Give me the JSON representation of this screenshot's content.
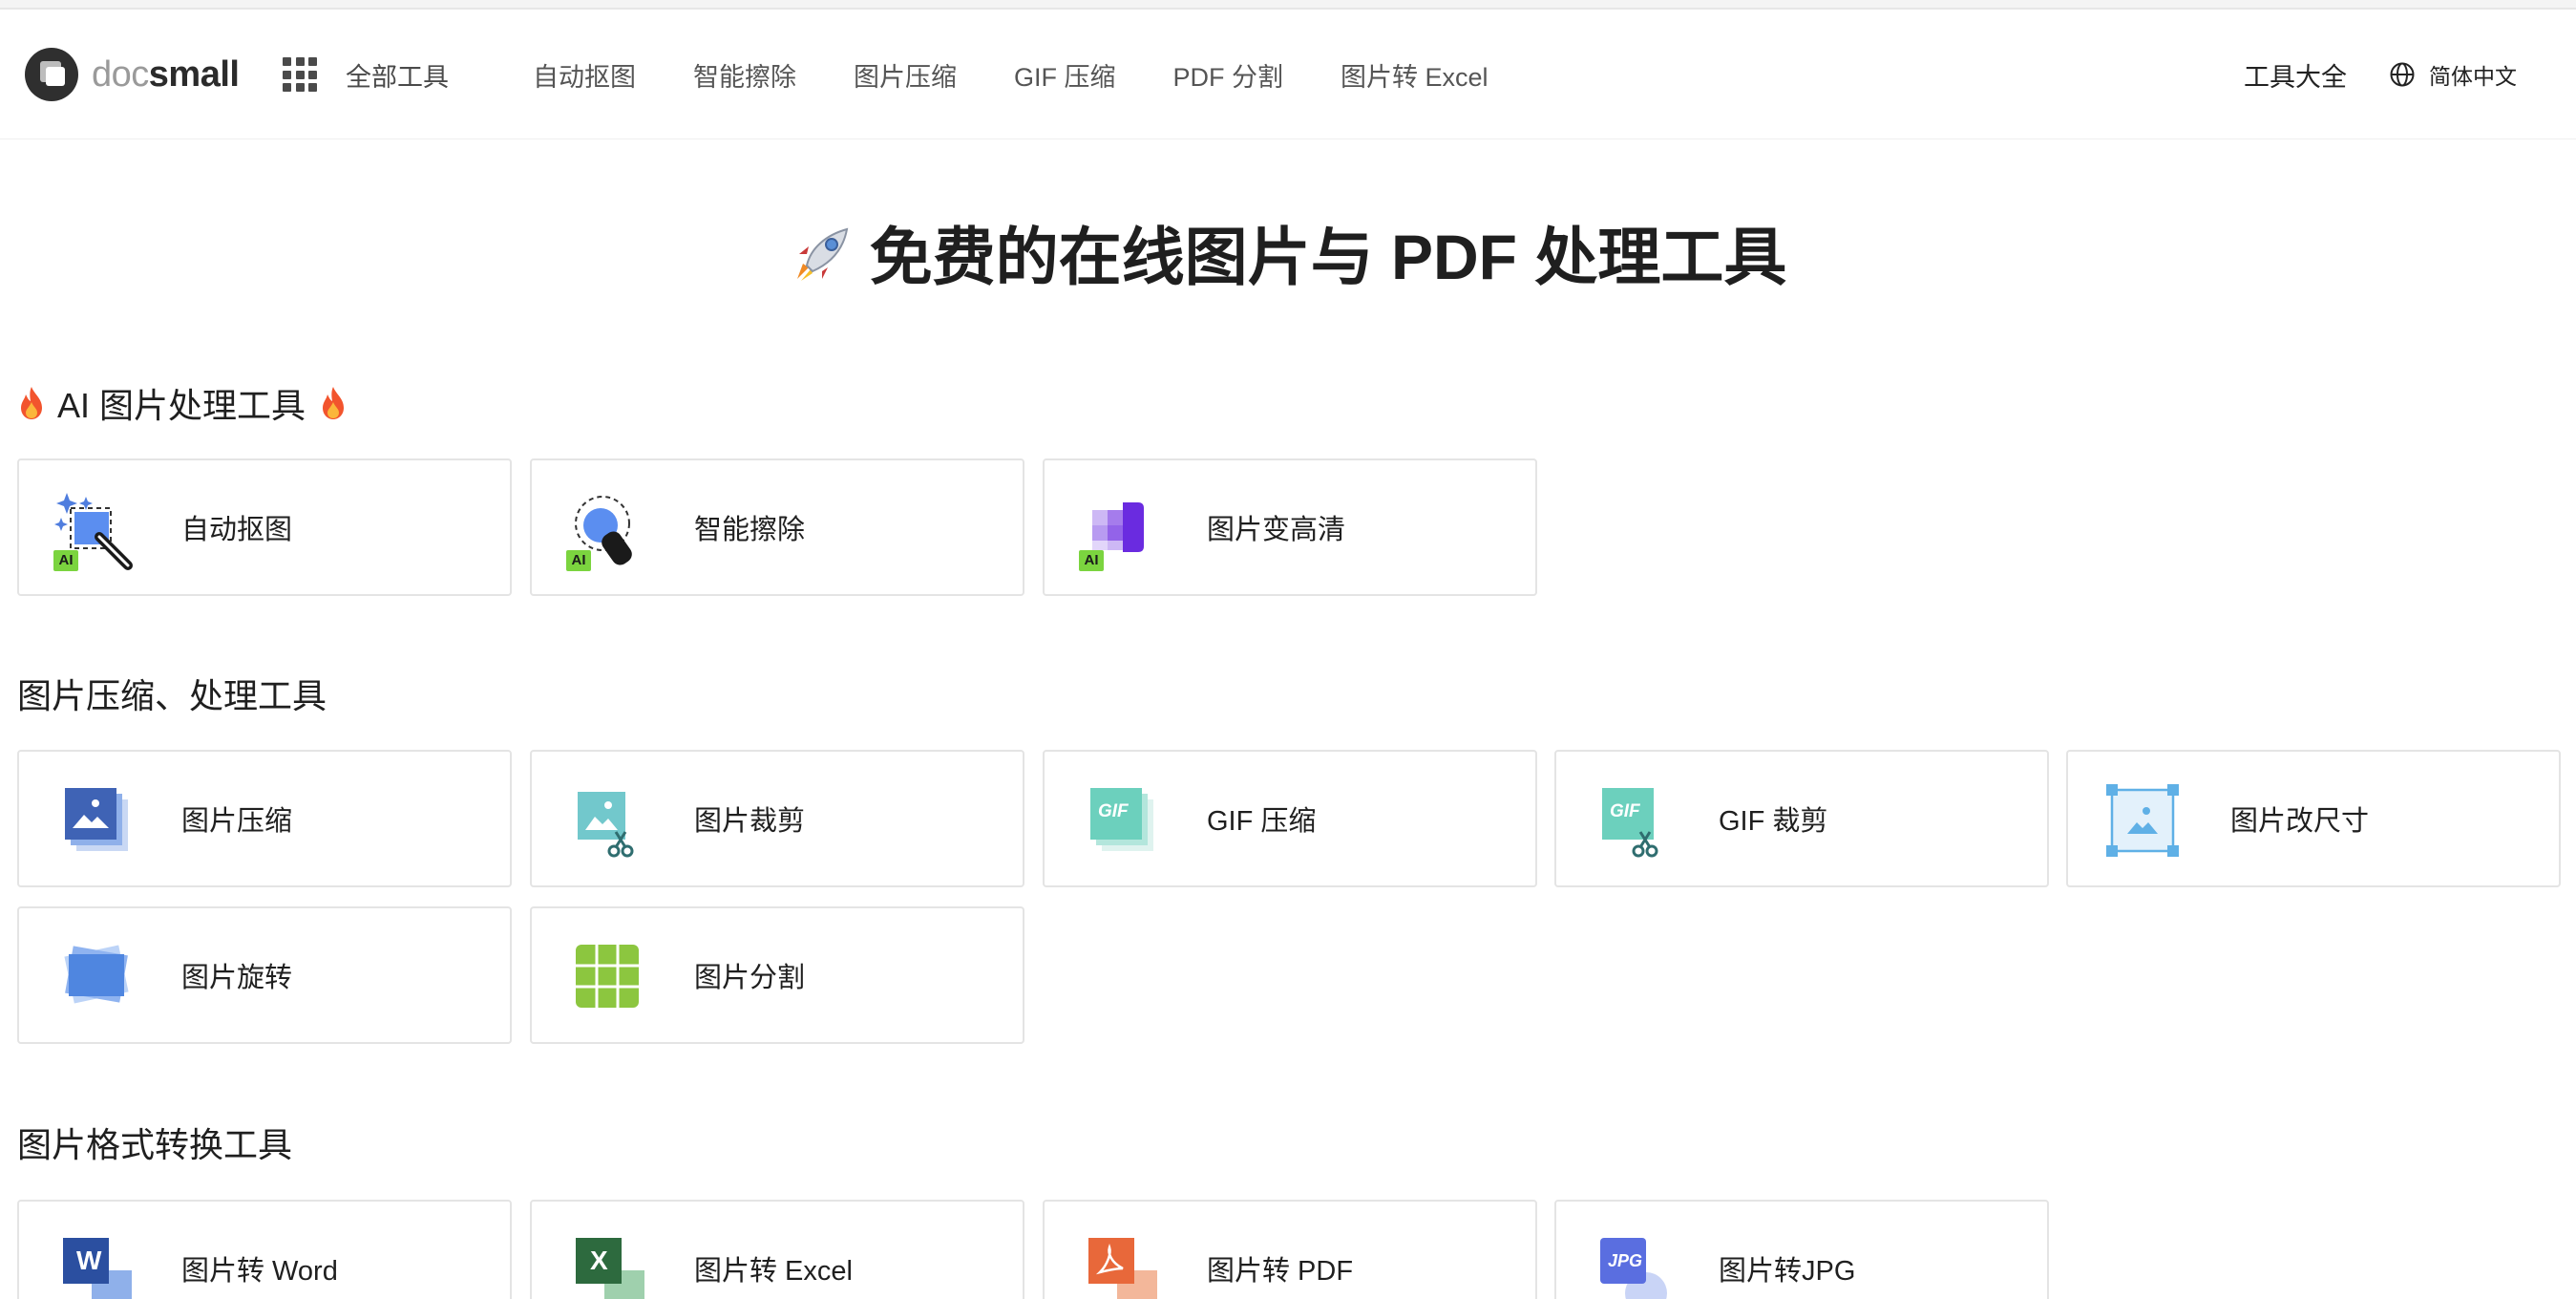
{
  "header": {
    "logo_text_light": "doc",
    "logo_text_bold": "small",
    "all_tools_label": "全部工具",
    "nav": [
      "自动抠图",
      "智能擦除",
      "图片压缩",
      "GIF 压缩",
      "PDF 分割",
      "图片转 Excel"
    ],
    "tools_all_label": "工具大全",
    "language_label": "简体中文"
  },
  "hero": {
    "title": "免费的在线图片与 PDF 处理工具"
  },
  "sections": {
    "ai": {
      "title": "AI 图片处理工具",
      "badge": "AI",
      "cards": [
        {
          "label": "自动抠图",
          "icon": "auto-cutout-icon"
        },
        {
          "label": "智能擦除",
          "icon": "smart-erase-icon"
        },
        {
          "label": "图片变高清",
          "icon": "image-upscale-icon"
        }
      ]
    },
    "compress": {
      "title": "图片压缩、处理工具",
      "cards": [
        {
          "label": "图片压缩",
          "icon": "image-compress-icon"
        },
        {
          "label": "图片裁剪",
          "icon": "image-crop-icon"
        },
        {
          "label": "GIF 压缩",
          "icon": "gif-compress-icon",
          "icon_text": "GIF"
        },
        {
          "label": "GIF 裁剪",
          "icon": "gif-crop-icon",
          "icon_text": "GIF"
        },
        {
          "label": "图片改尺寸",
          "icon": "image-resize-icon"
        },
        {
          "label": "图片旋转",
          "icon": "image-rotate-icon"
        },
        {
          "label": "图片分割",
          "icon": "image-split-icon"
        }
      ]
    },
    "convert": {
      "title": "图片格式转换工具",
      "cards": [
        {
          "label": "图片转 Word",
          "icon": "image-to-word-icon",
          "icon_text": "W"
        },
        {
          "label": "图片转 Excel",
          "icon": "image-to-excel-icon",
          "icon_text": "X"
        },
        {
          "label": "图片转 PDF",
          "icon": "image-to-pdf-icon"
        },
        {
          "label": "图片转JPG",
          "icon": "image-to-jpg-icon",
          "icon_text": "JPG"
        }
      ]
    }
  },
  "colors": {
    "ai_badge": "#7bd43f",
    "accent_blue": "#4f7dde",
    "purple": "#7b3fe4",
    "teal": "#5cc4c0",
    "word_blue": "#2b4fa0",
    "excel_green": "#2d6a3e",
    "pdf_orange": "#e8683a"
  }
}
